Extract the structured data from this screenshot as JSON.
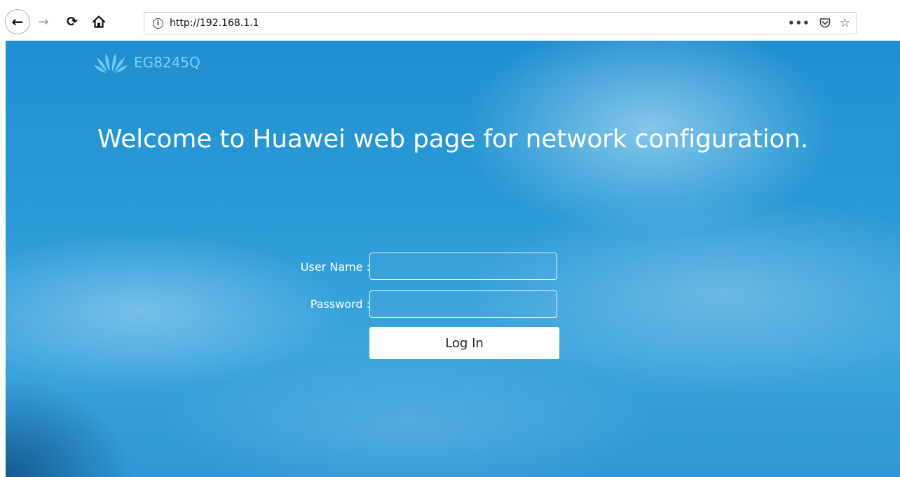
{
  "browser": {
    "url": "http://192.168.1.1",
    "icons": {
      "back": "back-arrow-icon",
      "forward": "forward-arrow-icon",
      "reload": "reload-icon",
      "home": "home-icon",
      "site_info": "info-icon",
      "page_actions": "more-icon",
      "pocket": "pocket-icon",
      "bookmark": "star-icon"
    }
  },
  "page": {
    "model": "EG8245Q",
    "welcome": "Welcome to Huawei web page for network configuration.",
    "form": {
      "username_label": "User Name :",
      "username_value": "",
      "password_label": "Password :",
      "password_value": "",
      "login_label": "Log In"
    }
  },
  "colors": {
    "background_blue": "#2a9ad6",
    "model_text": "#7fd0f3",
    "text": "#ffffff",
    "button_bg": "#ffffff"
  }
}
